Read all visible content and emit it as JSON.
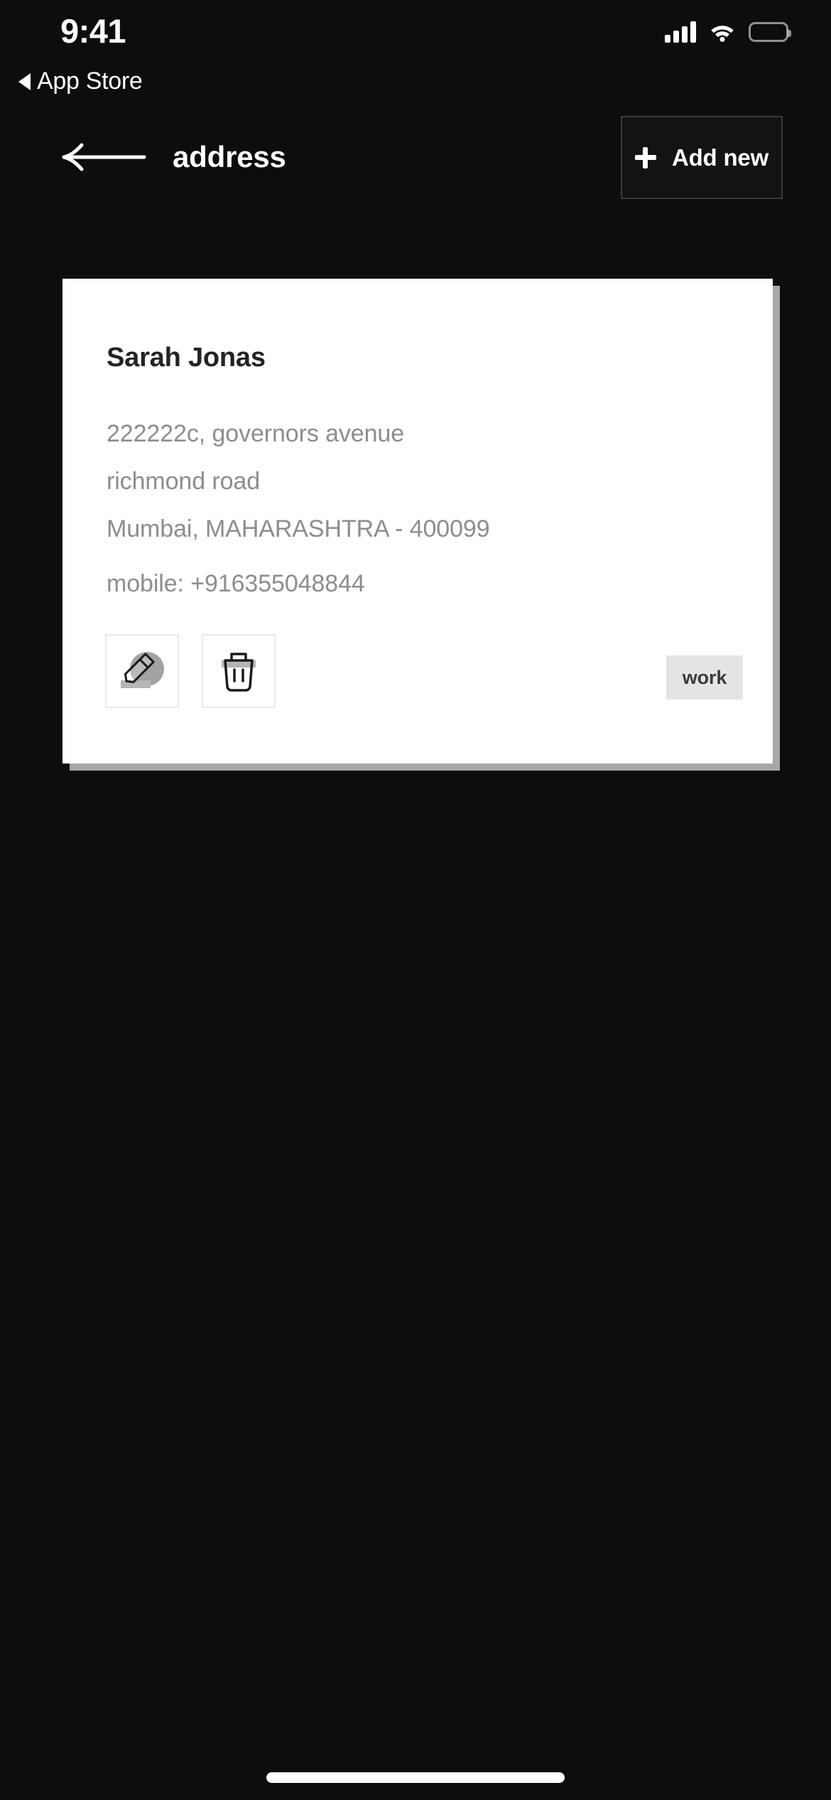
{
  "status_bar": {
    "time": "9:41",
    "return_app_label": "App Store",
    "icons": {
      "cellular": "cellular-signal-icon",
      "wifi": "wifi-icon",
      "battery": "battery-icon"
    }
  },
  "header": {
    "back_icon": "arrow-left-icon",
    "title": "address",
    "add_new": {
      "icon": "plus-icon",
      "label": "Add new"
    }
  },
  "address_card": {
    "name": "Sarah Jonas",
    "address_lines": [
      "222222c, governors avenue",
      "richmond road",
      "Mumbai, MAHARASHTRA - 400099"
    ],
    "contact": "mobile: +916355048844",
    "actions": [
      {
        "name": "edit-address-button",
        "icon": "pencil-edit-icon"
      },
      {
        "name": "delete-address-button",
        "icon": "trash-delete-icon"
      }
    ],
    "tag": "work"
  },
  "colors": {
    "page_background": "#0d0d0f",
    "card_background": "#ffffff",
    "card_shadow": "#a7a7a9",
    "name_text": "#232326",
    "muted_text": "#8d8d90",
    "badge_background": "#e4e4e6",
    "badge_text": "#3b3b3e",
    "button_border": "#3a3a3c",
    "icon_button_border": "#e9e9ea",
    "accent_text": "#ffffff"
  },
  "home_indicator": "home-indicator"
}
